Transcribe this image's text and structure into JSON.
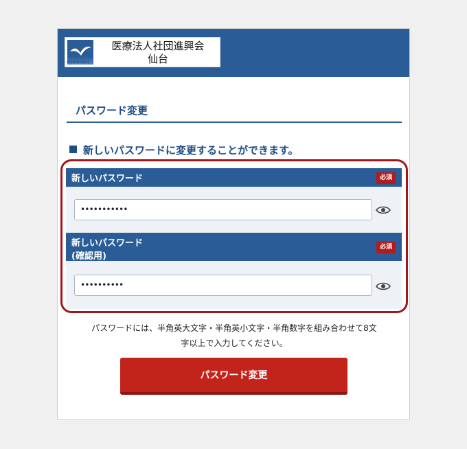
{
  "header": {
    "logo_subtext": "SHINKOKAI",
    "org_name_line1": "医療法人社団進興会",
    "org_name_line2": "仙台"
  },
  "page": {
    "title": "パスワード変更",
    "notice": "新しいパスワードに変更することができます。"
  },
  "form": {
    "fields": [
      {
        "label": "新しいパスワード",
        "label_line2": "",
        "required_badge": "必須",
        "masked_value": "•••••••••••",
        "toggle_icon": "eye-icon"
      },
      {
        "label": "新しいパスワード",
        "label_line2": "(確認用)",
        "required_badge": "必須",
        "masked_value": "••••••••••",
        "toggle_icon": "eye-icon"
      }
    ],
    "hint_line1": "パスワードには、半角英大文字・半角英小文字・半角数字を組み合わせて8文",
    "hint_line2": "字以上で入力してください。",
    "submit_label": "パスワード変更"
  },
  "colors": {
    "header_bg": "#2a5d97",
    "heading_text": "#1f4e86",
    "required_badge": "#b41b1b",
    "submit_button": "#c2241b",
    "highlight_border": "#a3161b"
  }
}
